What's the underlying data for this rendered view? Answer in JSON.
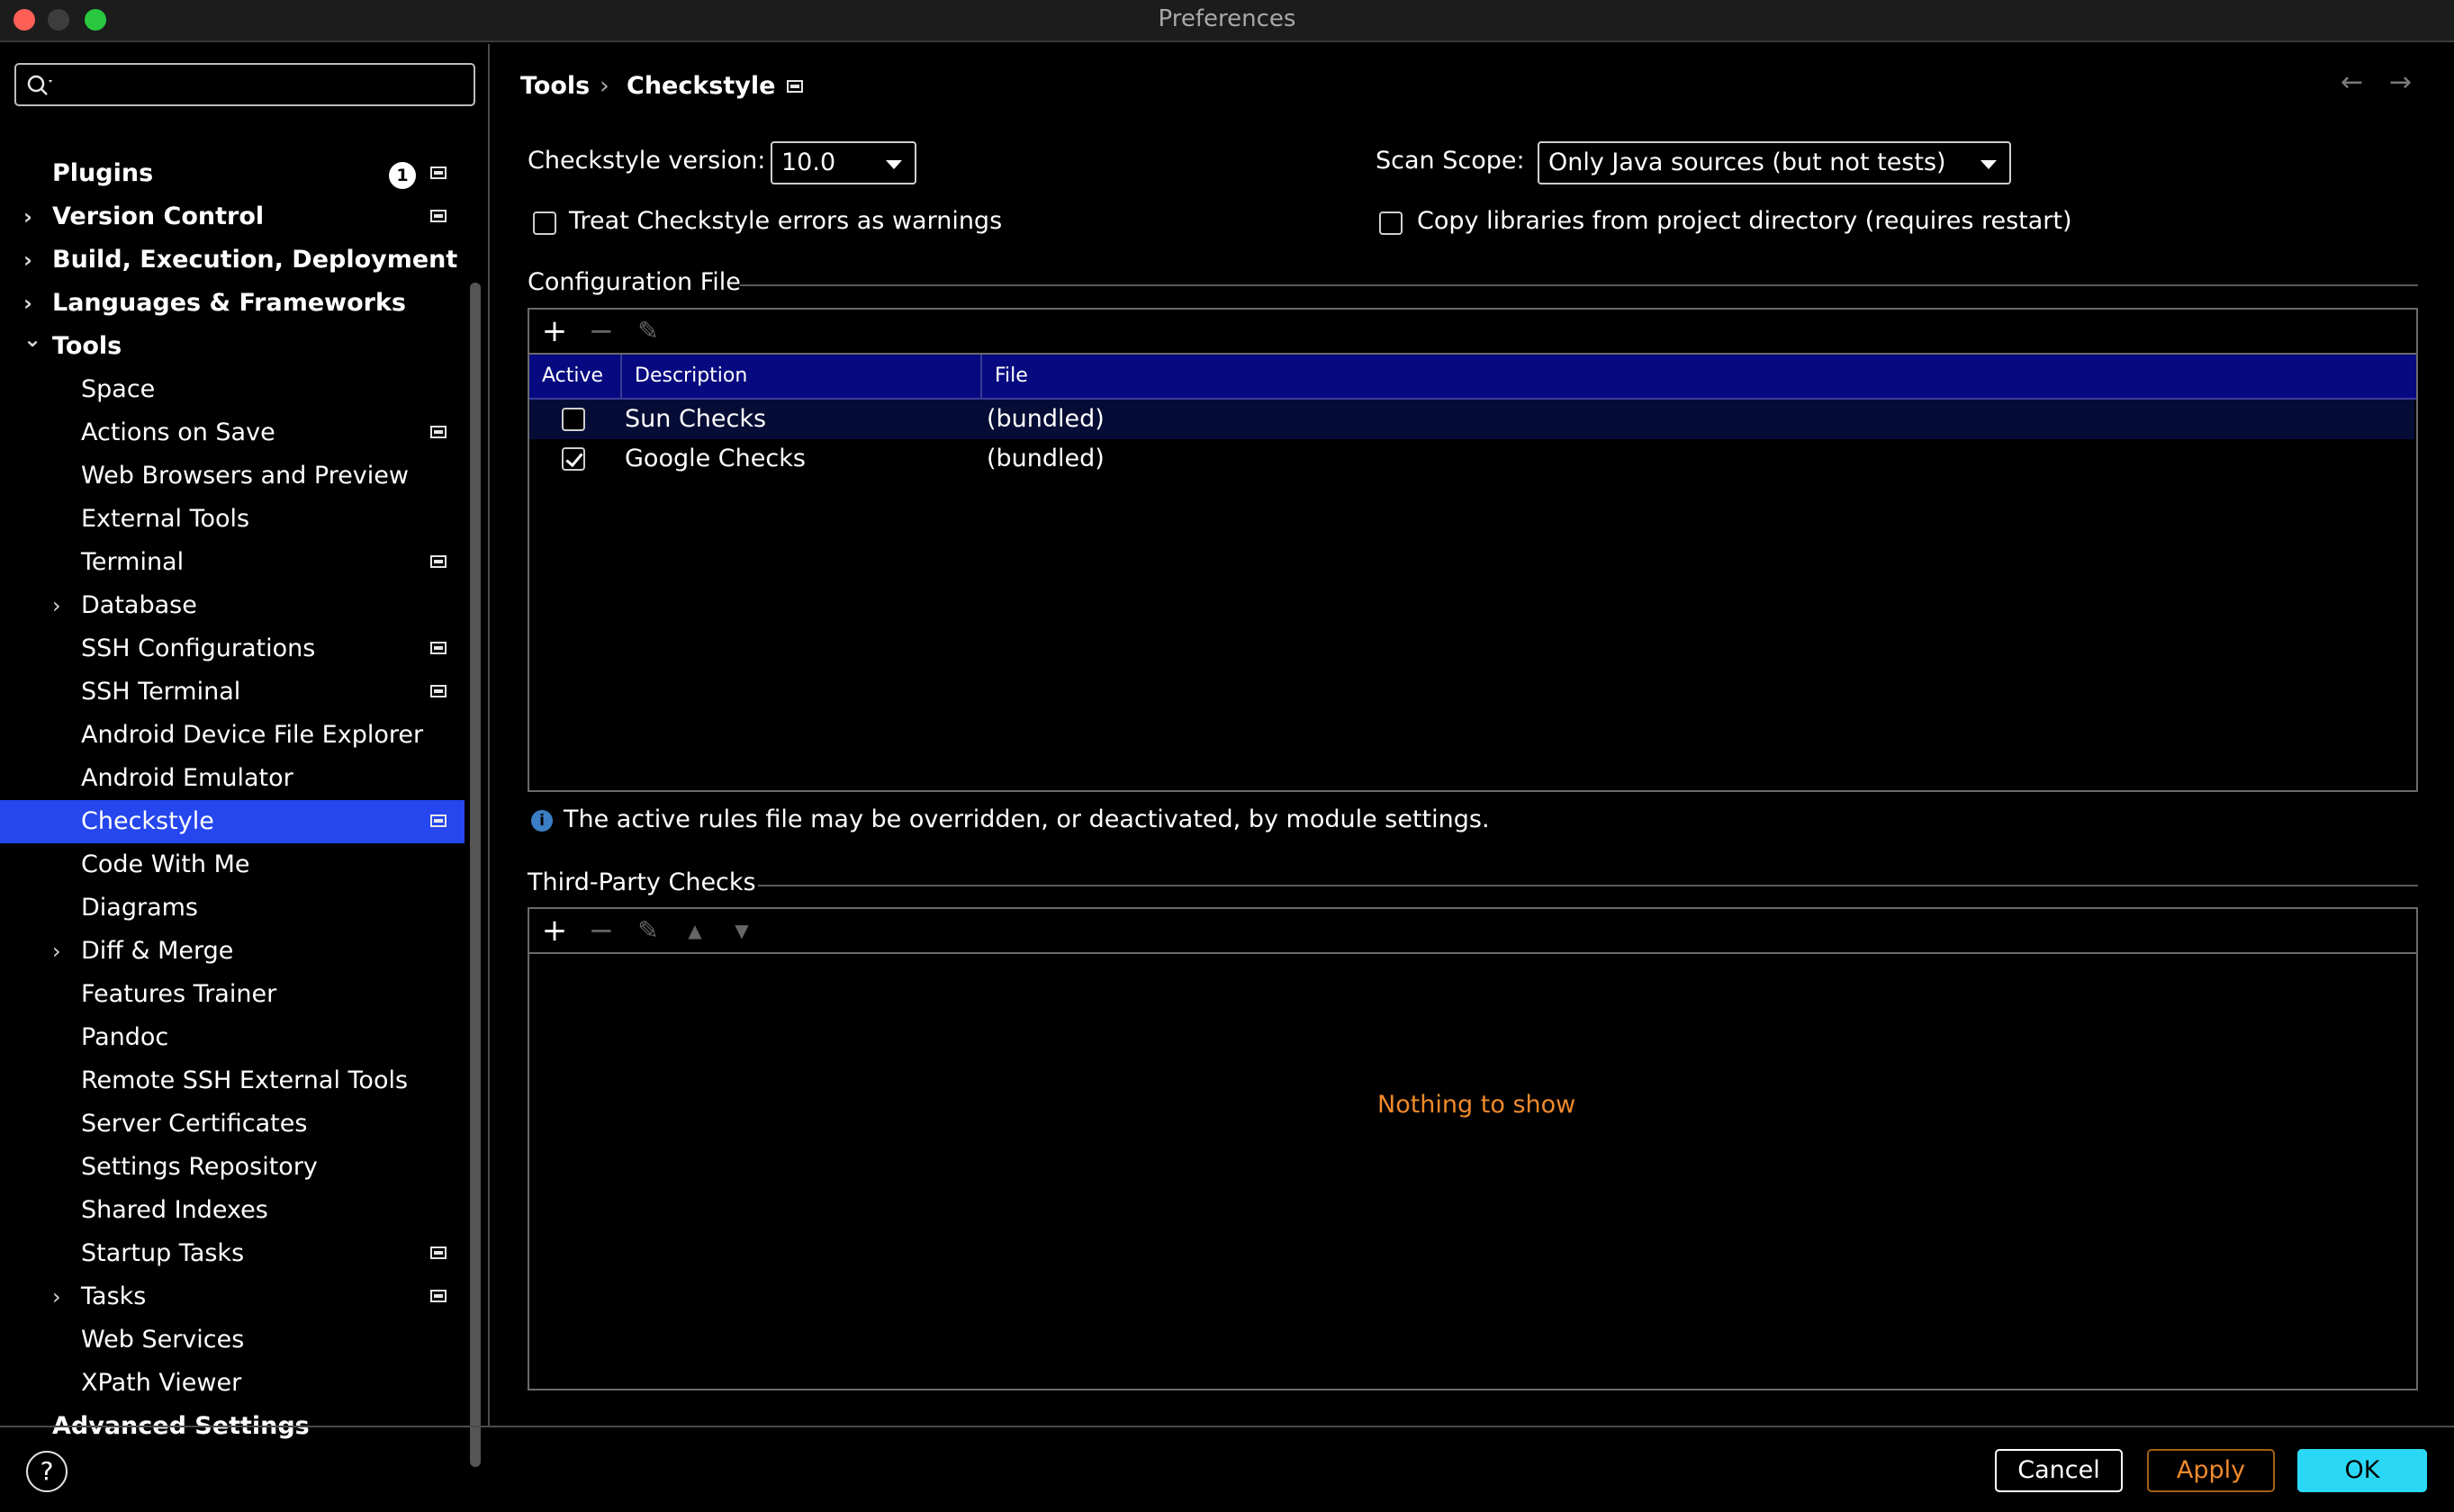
{
  "window": {
    "title": "Preferences"
  },
  "sidebar": {
    "search": {
      "value": "",
      "placeholder": ""
    },
    "items": [
      {
        "label": "Plugins",
        "bold": true,
        "level": 0,
        "badge": "1",
        "project_icon": true
      },
      {
        "label": "Version Control",
        "bold": true,
        "level": 0,
        "expandable": true,
        "expanded": false,
        "project_icon": true
      },
      {
        "label": "Build, Execution, Deployment",
        "bold": true,
        "level": 0,
        "expandable": true,
        "expanded": false
      },
      {
        "label": "Languages & Frameworks",
        "bold": true,
        "level": 0,
        "expandable": true,
        "expanded": false
      },
      {
        "label": "Tools",
        "bold": true,
        "level": 0,
        "expandable": true,
        "expanded": true
      },
      {
        "label": "Space",
        "level": 1
      },
      {
        "label": "Actions on Save",
        "level": 1,
        "project_icon": true
      },
      {
        "label": "Web Browsers and Preview",
        "level": 1
      },
      {
        "label": "External Tools",
        "level": 1
      },
      {
        "label": "Terminal",
        "level": 1,
        "project_icon": true
      },
      {
        "label": "Database",
        "level": 1,
        "expandable": true,
        "expanded": false
      },
      {
        "label": "SSH Configurations",
        "level": 1,
        "project_icon": true
      },
      {
        "label": "SSH Terminal",
        "level": 1,
        "project_icon": true
      },
      {
        "label": "Android Device File Explorer",
        "level": 1
      },
      {
        "label": "Android Emulator",
        "level": 1
      },
      {
        "label": "Checkstyle",
        "level": 1,
        "selected": true,
        "project_icon": true
      },
      {
        "label": "Code With Me",
        "level": 1
      },
      {
        "label": "Diagrams",
        "level": 1
      },
      {
        "label": "Diff & Merge",
        "level": 1,
        "expandable": true,
        "expanded": false
      },
      {
        "label": "Features Trainer",
        "level": 1
      },
      {
        "label": "Pandoc",
        "level": 1
      },
      {
        "label": "Remote SSH External Tools",
        "level": 1
      },
      {
        "label": "Server Certificates",
        "level": 1
      },
      {
        "label": "Settings Repository",
        "level": 1
      },
      {
        "label": "Shared Indexes",
        "level": 1
      },
      {
        "label": "Startup Tasks",
        "level": 1,
        "project_icon": true
      },
      {
        "label": "Tasks",
        "level": 1,
        "expandable": true,
        "expanded": false,
        "project_icon": true
      },
      {
        "label": "Web Services",
        "level": 1
      },
      {
        "label": "XPath Viewer",
        "level": 1
      },
      {
        "label": "Advanced Settings",
        "bold": true,
        "level": 0
      }
    ]
  },
  "breadcrumb": {
    "parent": "Tools",
    "separator": "›",
    "current": "Checkstyle",
    "back_icon": "arrow-left-icon",
    "forward_icon": "arrow-right-icon"
  },
  "settings": {
    "version_label": "Checkstyle version:",
    "version_value": "10.0",
    "scan_scope_label": "Scan Scope:",
    "scan_scope_value": "Only Java sources (but not tests)",
    "treat_errors_label": "Treat Checkstyle errors as warnings",
    "treat_errors_checked": false,
    "copy_libs_label": "Copy libraries from project directory (requires restart)",
    "copy_libs_checked": false
  },
  "config_file": {
    "title": "Configuration File",
    "toolbar": {
      "add": "+",
      "remove": "−",
      "edit": "✎"
    },
    "columns": [
      "Active",
      "Description",
      "File"
    ],
    "rows": [
      {
        "active": false,
        "description": "Sun Checks",
        "file": "(bundled)"
      },
      {
        "active": true,
        "description": "Google Checks",
        "file": "(bundled)"
      }
    ],
    "info_icon": "i",
    "info_text": "The active rules file may be overridden, or deactivated, by module settings."
  },
  "third_party": {
    "title": "Third-Party Checks",
    "toolbar": {
      "add": "+",
      "remove": "−",
      "edit": "✎",
      "up": "▲",
      "down": "▼"
    },
    "empty_text": "Nothing to show"
  },
  "footer": {
    "help": "?",
    "cancel": "Cancel",
    "apply": "Apply",
    "ok": "OK"
  },
  "colors": {
    "selection": "#2646ee",
    "table_header": "#06097f",
    "apply_text": "#f08a2b",
    "ok_background": "#2ad8f6"
  }
}
